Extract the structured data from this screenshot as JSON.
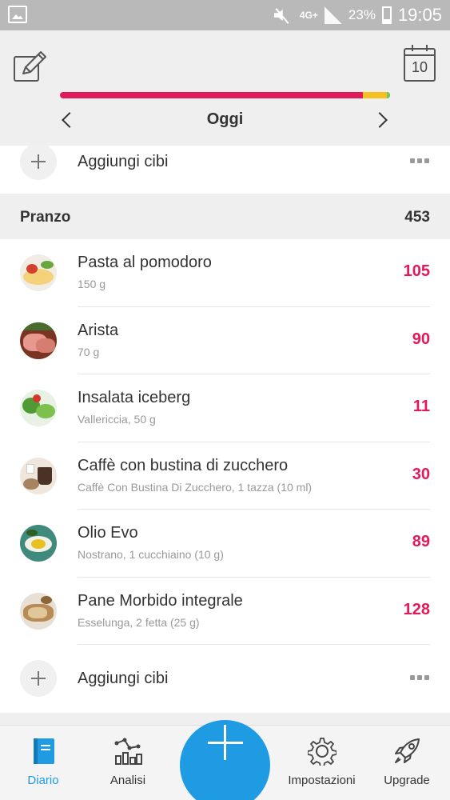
{
  "status_bar": {
    "network": "4G+",
    "battery": "23%",
    "time": "19:05"
  },
  "header": {
    "calendar_day": "10",
    "date_title": "Oggi",
    "progress_fraction": 0.92,
    "colors": {
      "progress": "#e2195a",
      "over": "#f6c022",
      "end": "#6dcb5b"
    }
  },
  "add_food_label": "Aggiungi cibi",
  "lunch": {
    "title": "Pranzo",
    "total": "453",
    "items": [
      {
        "name": "Pasta al pomodoro",
        "detail": "150 g",
        "kcal": "105",
        "icon": "pasta-thumb"
      },
      {
        "name": "Arista",
        "detail": "70 g",
        "kcal": "90",
        "icon": "pork-thumb"
      },
      {
        "name": "Insalata iceberg",
        "detail": "Vallericcia, 50 g",
        "kcal": "11",
        "icon": "salad-thumb"
      },
      {
        "name": "Caffè con bustina di zucchero",
        "detail": "Caffè Con Bustina Di Zucchero, 1 tazza (10 ml)",
        "kcal": "30",
        "icon": "coffee-thumb"
      },
      {
        "name": "Olio Evo",
        "detail": "Nostrano, 1 cucchiaino (10 g)",
        "kcal": "89",
        "icon": "oil-thumb"
      },
      {
        "name": "Pane Morbido integrale",
        "detail": "Esselunga, 2 fetta (25 g)",
        "kcal": "128",
        "icon": "bread-thumb"
      }
    ]
  },
  "bottom_nav": {
    "tabs": [
      {
        "label": "Diario",
        "icon": "diary-icon",
        "active": true
      },
      {
        "label": "Analisi",
        "icon": "analysis-icon",
        "active": false
      },
      {
        "label": "Impostazioni",
        "icon": "gear-icon",
        "active": false
      },
      {
        "label": "Upgrade",
        "icon": "rocket-icon",
        "active": false
      }
    ],
    "accent": "#1e9be2"
  }
}
